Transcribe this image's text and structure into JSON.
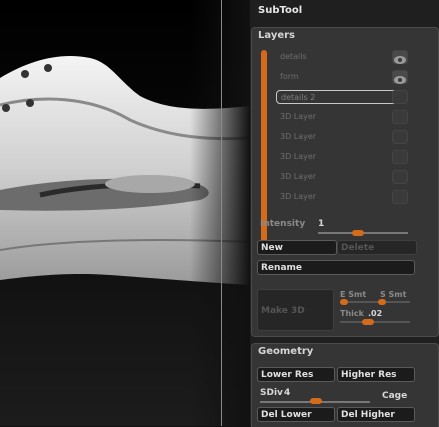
{
  "panel": {
    "title": "SubTool"
  },
  "layers": {
    "header": "Layers",
    "items": [
      {
        "label": "details",
        "visible": true
      },
      {
        "label": "form",
        "visible": true
      },
      {
        "label": "details 2",
        "visible": false,
        "selected": true
      },
      {
        "label": "3D Layer",
        "visible": false
      },
      {
        "label": "3D Layer",
        "visible": false
      },
      {
        "label": "3D Layer",
        "visible": false
      },
      {
        "label": "3D Layer",
        "visible": false
      },
      {
        "label": "3D Layer",
        "visible": false
      }
    ],
    "intensity_label": "Intensity",
    "intensity_value": "1",
    "new_label": "New",
    "delete_label": "Delete",
    "rename_label": "Rename",
    "make3d_label": "Make 3D",
    "esmt_label": "E Smt",
    "ssmt_label": "S Smt",
    "thick_label": "Thick",
    "thick_value": ".02"
  },
  "geometry": {
    "header": "Geometry",
    "lower_res_label": "Lower Res",
    "higher_res_label": "Higher Res",
    "sdiv_label": "SDiv",
    "sdiv_value": "4",
    "cage_label": "Cage",
    "del_lower_label": "Del Lower",
    "del_higher_label": "Del Higher"
  },
  "colors": {
    "accent": "#d46a1a",
    "panel_bg": "#353535"
  }
}
